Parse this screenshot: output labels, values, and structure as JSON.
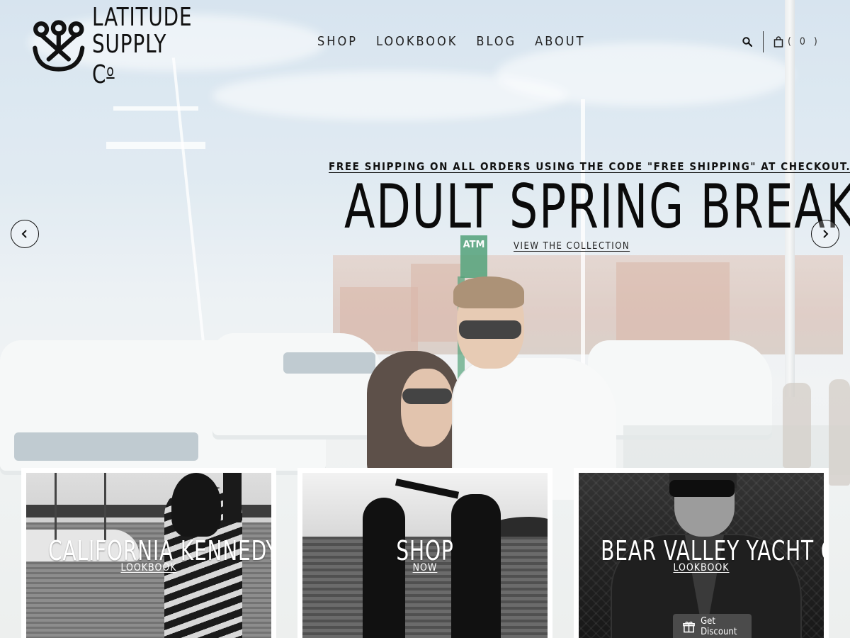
{
  "brand": {
    "line1": "LATITUDE",
    "line2": "SUPPLY C",
    "line2_sup": "o"
  },
  "nav": {
    "items": [
      {
        "label": "SHOP"
      },
      {
        "label": "LOOKBOOK"
      },
      {
        "label": "BLOG"
      },
      {
        "label": "ABOUT"
      }
    ]
  },
  "header": {
    "search_icon": "search-icon",
    "cart_icon": "shopping-bag-icon",
    "cart_count": "( 0 )"
  },
  "hero": {
    "promo": "FREE SHIPPING ON ALL ORDERS USING THE CODE \"FREE SHIPPING\" AT CHECKOUT.",
    "headline": "ADULT SPRING BREAK.",
    "cta": "VIEW THE COLLECTION",
    "atm_sign": "ATM",
    "prev_icon": "chevron-left-icon",
    "next_icon": "chevron-right-icon"
  },
  "tiles": [
    {
      "title": "CALIFORNIA KENNEDY",
      "subtitle": "LOOKBOOK"
    },
    {
      "title": "SHOP",
      "subtitle": "NOW"
    },
    {
      "title": "BEAR VALLEY YACHT CLUB",
      "subtitle": "LOOKBOOK"
    }
  ],
  "discount_button": {
    "label": "Get Discount",
    "icon": "gift-icon"
  }
}
